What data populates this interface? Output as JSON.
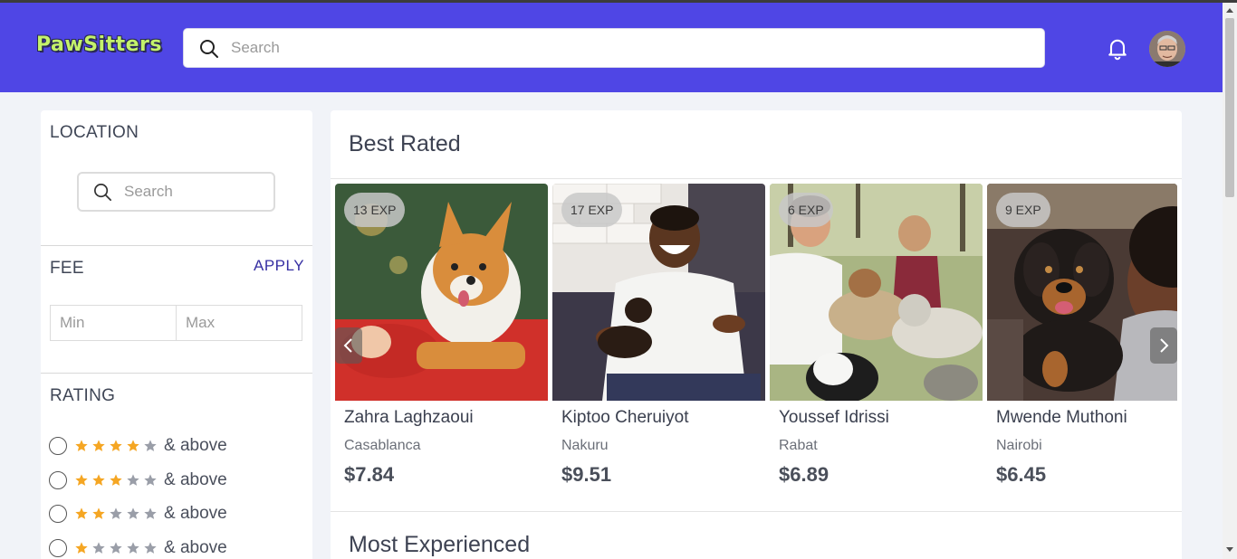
{
  "header": {
    "logo": "PawSitters",
    "search_placeholder": "Search",
    "bell_icon": "bell-icon",
    "avatar_icon": "user-avatar",
    "brand_color": "#4f46e5",
    "logo_color": "#c4f26b"
  },
  "filters": {
    "location": {
      "title": "LOCATION",
      "search_placeholder": "Search"
    },
    "fee": {
      "title": "FEE",
      "apply_label": "APPLY",
      "min_placeholder": "Min",
      "max_placeholder": "Max"
    },
    "rating": {
      "title": "RATING",
      "star_color": "#f5a623",
      "options": [
        {
          "stars": 4,
          "label": "& above"
        },
        {
          "stars": 3,
          "label": "& above"
        },
        {
          "stars": 2,
          "label": "& above"
        },
        {
          "stars": 1,
          "label": "& above"
        }
      ]
    }
  },
  "sections": {
    "best_rated": {
      "title": "Best Rated",
      "sitters": [
        {
          "exp": "13 EXP",
          "name": "Zahra Laghzaoui",
          "city": "Casablanca",
          "price": "$7.84"
        },
        {
          "exp": "17 EXP",
          "name": "Kiptoo Cheruiyot",
          "city": "Nakuru",
          "price": "$9.51"
        },
        {
          "exp": "6 EXP",
          "name": "Youssef Idrissi",
          "city": "Rabat",
          "price": "$6.89"
        },
        {
          "exp": "9 EXP",
          "name": "Mwende Muthoni",
          "city": "Nairobi",
          "price": "$6.45"
        }
      ]
    },
    "most_experienced": {
      "title": "Most Experienced"
    }
  }
}
